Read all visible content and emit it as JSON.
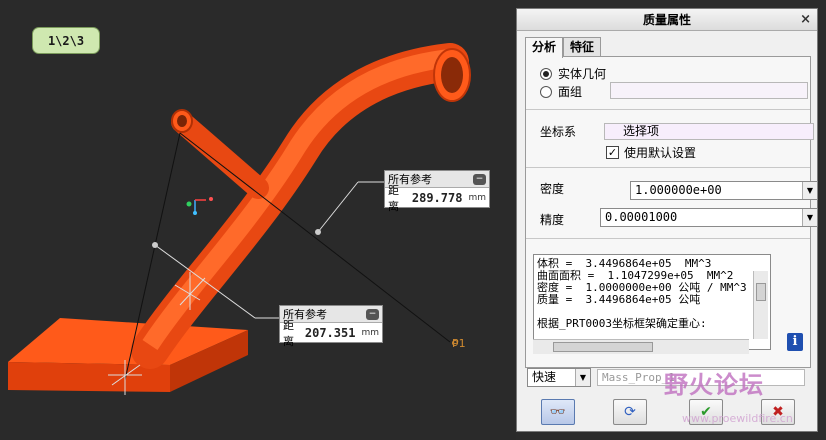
{
  "viewport": {
    "view_badge": "1\\2\\3",
    "dim_top": {
      "header": "所有参考",
      "label": "距离",
      "value": "289.778",
      "unit": "mm"
    },
    "dim_bottom": {
      "header": "所有参考",
      "label": "距离",
      "value": "207.351",
      "unit": "mm"
    },
    "point_label": "P1",
    "part_color": "#ff5a1a",
    "line_color": "#111111"
  },
  "dialog": {
    "title": "质量属性",
    "close_glyph": "×",
    "tabs": [
      {
        "label": "分析",
        "active": true
      },
      {
        "label": "特征",
        "active": false
      }
    ],
    "geometry_options": [
      {
        "label": "实体几何",
        "selected": true
      },
      {
        "label": "面组",
        "selected": false
      }
    ],
    "csys_label": "坐标系",
    "csys_field": "选择项",
    "use_default_label": "使用默认设置",
    "use_default_checked": true,
    "density_label": "密度",
    "density_value": "1.000000e+00",
    "precision_label": "精度",
    "precision_value": "0.00001000",
    "results": [
      "体积 =  3.4496864e+05  MM^3",
      "曲面面积 =  1.1047299e+05  MM^2",
      "密度 =  1.0000000e+00 公吨 / MM^3",
      "质量 =  3.4496864e+05 公吨",
      "",
      "根据_PRT0003坐标框架确定重心:"
    ],
    "mode_value": "快速",
    "name_value": "Mass_Prop_1",
    "info_glyph": "i",
    "check_glyph": "✔",
    "cancel_glyph": "✖"
  },
  "watermark": {
    "text": "野火论坛",
    "url": "www.proewildfire.cn"
  }
}
